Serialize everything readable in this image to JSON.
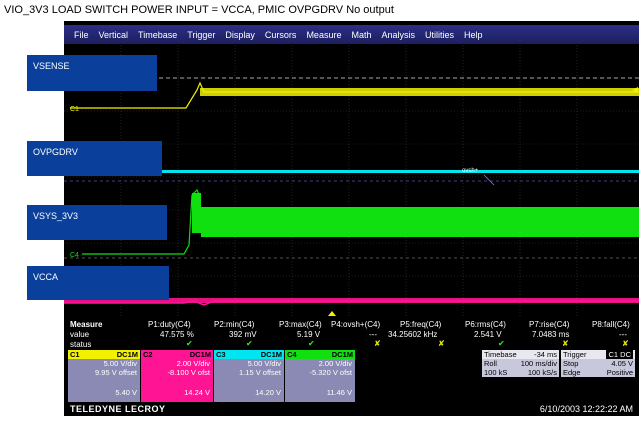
{
  "title": "VIO_3V3 LOAD SWITCH POWER INPUT = VCCA, PMIC OVPGDRV No output",
  "menu": [
    "File",
    "Vertical",
    "Timebase",
    "Trigger",
    "Display",
    "Cursors",
    "Measure",
    "Math",
    "Analysis",
    "Utilities",
    "Help"
  ],
  "traces": [
    {
      "label": "VSENSE",
      "color": "#f2f200"
    },
    {
      "label": "OVPGDRV",
      "color": "#00e5f0"
    },
    {
      "label": "VSYS_3V3",
      "color": "#10e010"
    },
    {
      "label": "VCCA",
      "color": "#ff1493"
    }
  ],
  "markers": {
    "c1": "C1",
    "c4": "C4",
    "ovshp": "ovsh+"
  },
  "measure": {
    "row_labels": [
      "Measure",
      "value",
      "status"
    ],
    "params": [
      {
        "name": "P1:duty(C4)",
        "value": "47.575 %"
      },
      {
        "name": "P2:min(C4)",
        "value": "392 mV"
      },
      {
        "name": "P3:max(C4)",
        "value": "5.19 V"
      },
      {
        "name": "P4:ovsh+(C4)",
        "value": "---"
      },
      {
        "name": "P5:freq(C4)",
        "value": "34.25602 kHz"
      },
      {
        "name": "P6:rms(C4)",
        "value": "2.541 V"
      },
      {
        "name": "P7:rise(C4)",
        "value": "7.0483 ms"
      },
      {
        "name": "P8:fall(C4)",
        "value": "---"
      }
    ]
  },
  "channels": [
    {
      "id": "C1",
      "coupling": "DC1M",
      "vdiv": "5.00 V/div",
      "offset": "9.95 V offset",
      "last": "5.40 V",
      "color": "#f2f200"
    },
    {
      "id": "C2",
      "coupling": "DC1M",
      "vdiv": "2.00 V/div",
      "offset": "-8.100 V ofst",
      "last": "14.24 V",
      "color": "#ff1493"
    },
    {
      "id": "C3",
      "coupling": "DC1M",
      "vdiv": "5.00 V/div",
      "offset": "1.15 V offset",
      "last": "14.20 V",
      "color": "#00e5f0"
    },
    {
      "id": "C4",
      "coupling": "DC1M",
      "vdiv": "2.00 V/div",
      "offset": "-5.320 V ofst",
      "last": "11.46 V",
      "color": "#10e010"
    }
  ],
  "timebase": {
    "label": "Timebase",
    "delay": "-34 ms",
    "mode": "Roll",
    "tdiv": "100 ms/div",
    "samples": "100 kS",
    "rate": "100 kS/s"
  },
  "trigger": {
    "label": "Trigger",
    "source": "C1 DC",
    "mode": "Stop",
    "level": "4.05 V",
    "type": "Edge",
    "slope": "Positive"
  },
  "footer": {
    "brand": "TELEDYNE LECROY",
    "datetime": "6/10/2003 12:22:22 AM"
  }
}
